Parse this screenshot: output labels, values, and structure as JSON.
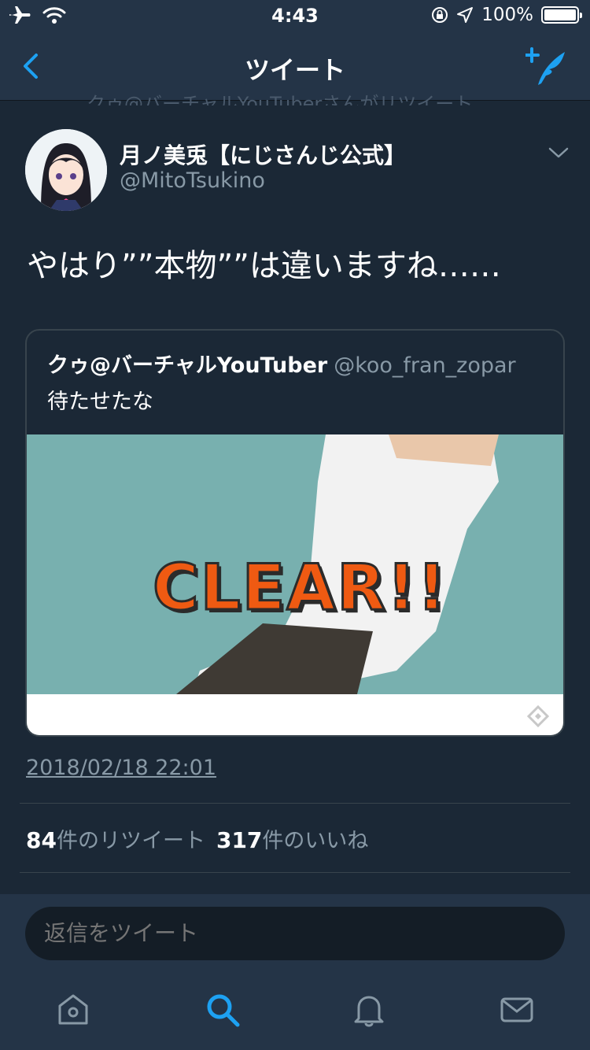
{
  "status_bar": {
    "time": "4:43",
    "battery": "100%",
    "battery_level": 1.0
  },
  "nav": {
    "title": "ツイート"
  },
  "retweet_context": "クゥ@バーチャルYouTuberさんがリツイート",
  "tweet": {
    "user_name": "月ノ美兎【にじさんじ公式】",
    "user_handle": "@MitoTsukino",
    "text": "やはり””本物””は違いますね……",
    "quote": {
      "name": "クゥ@バーチャルYouTuber",
      "handle": "@koo_fran_zopar",
      "text": "待たせたな",
      "media_text": "CLEAR!!"
    },
    "timestamp": "2018/02/18 22:01",
    "retweets_count": "84",
    "retweets_label": "件のリツイート",
    "likes_count": "317",
    "likes_label": "件のいいね"
  },
  "reply": {
    "placeholder": "返信をツイート"
  },
  "tabs": [
    "home-icon",
    "search-icon",
    "notifications-icon",
    "messages-icon"
  ],
  "colors": {
    "background": "#1b2836",
    "bar": "#243447",
    "accent": "#1da1f2",
    "secondary_text": "#8899a6"
  }
}
